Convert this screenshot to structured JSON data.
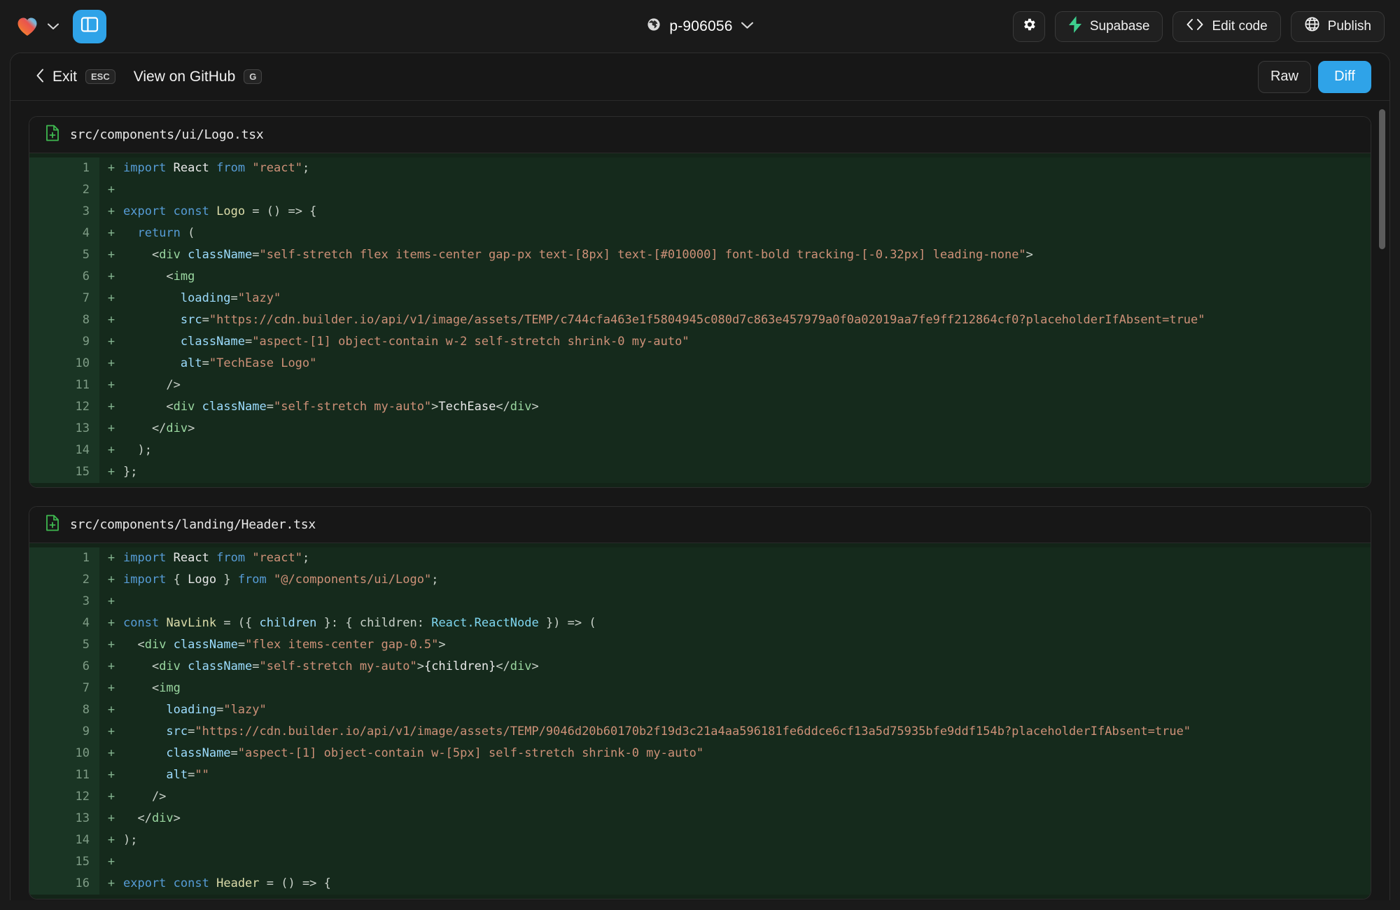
{
  "topbar": {
    "logo_icon": "heart-gradient-logo",
    "logo_chevron_icon": "chevron-down-icon",
    "panel_toggle_icon": "sidebar-panel-icon",
    "project": {
      "globe_icon": "globe-icon",
      "name": "p-906056",
      "chevron_icon": "chevron-down-icon"
    },
    "buttons": [
      {
        "id": "settings",
        "label": "",
        "icon": "gear-icon"
      },
      {
        "id": "supabase",
        "label": "Supabase",
        "icon": "supabase-bolt-icon"
      },
      {
        "id": "edit-code",
        "label": "Edit code",
        "icon": "code-brackets-icon"
      },
      {
        "id": "publish",
        "label": "Publish",
        "icon": "globe-icon"
      }
    ]
  },
  "panel_header": {
    "exit_label": "Exit",
    "exit_kbd": "ESC",
    "back_chevron_icon": "chevron-left-icon",
    "github_label": "View on GitHub",
    "github_kbd": "G",
    "view_modes": [
      {
        "id": "raw",
        "label": "Raw",
        "active": false
      },
      {
        "id": "diff",
        "label": "Diff",
        "active": true
      }
    ]
  },
  "colors": {
    "accent_blue": "#2fa3e8",
    "added_bg": "#152a1c",
    "added_gutter": "#1a3524",
    "file_icon_green": "#3fb950",
    "panel_bg": "#171717",
    "app_bg": "#1a1a1a"
  },
  "files": [
    {
      "path": "src/components/ui/Logo.tsx",
      "status_icon": "file-added-icon",
      "lines": [
        {
          "n": 1,
          "sign": "+",
          "spans": [
            {
              "t": "import",
              "c": "kw"
            },
            {
              "t": " ",
              "c": "pun"
            },
            {
              "t": "React",
              "c": "id"
            },
            {
              "t": " ",
              "c": "pun"
            },
            {
              "t": "from",
              "c": "kw"
            },
            {
              "t": " ",
              "c": "pun"
            },
            {
              "t": "\"react\"",
              "c": "str"
            },
            {
              "t": ";",
              "c": "pun"
            }
          ]
        },
        {
          "n": 2,
          "sign": "+",
          "spans": []
        },
        {
          "n": 3,
          "sign": "+",
          "spans": [
            {
              "t": "export",
              "c": "kw"
            },
            {
              "t": " ",
              "c": "pun"
            },
            {
              "t": "const",
              "c": "kw"
            },
            {
              "t": " ",
              "c": "pun"
            },
            {
              "t": "Logo",
              "c": "yel"
            },
            {
              "t": " = () => {",
              "c": "pun"
            }
          ]
        },
        {
          "n": 4,
          "sign": "+",
          "spans": [
            {
              "t": "  ",
              "c": "pun"
            },
            {
              "t": "return",
              "c": "kw"
            },
            {
              "t": " (",
              "c": "pun"
            }
          ]
        },
        {
          "n": 5,
          "sign": "+",
          "spans": [
            {
              "t": "    <",
              "c": "pun"
            },
            {
              "t": "div",
              "c": "tag"
            },
            {
              "t": " ",
              "c": "pun"
            },
            {
              "t": "className",
              "c": "attr"
            },
            {
              "t": "=",
              "c": "pun"
            },
            {
              "t": "\"self-stretch flex items-center gap-px text-[8px] text-[#010000] font-bold tracking-[-0.32px] leading-none\"",
              "c": "str"
            },
            {
              "t": ">",
              "c": "pun"
            }
          ]
        },
        {
          "n": 6,
          "sign": "+",
          "spans": [
            {
              "t": "      <",
              "c": "pun"
            },
            {
              "t": "img",
              "c": "tag"
            }
          ]
        },
        {
          "n": 7,
          "sign": "+",
          "spans": [
            {
              "t": "        ",
              "c": "pun"
            },
            {
              "t": "loading",
              "c": "attr"
            },
            {
              "t": "=",
              "c": "pun"
            },
            {
              "t": "\"lazy\"",
              "c": "str"
            }
          ]
        },
        {
          "n": 8,
          "sign": "+",
          "spans": [
            {
              "t": "        ",
              "c": "pun"
            },
            {
              "t": "src",
              "c": "attr"
            },
            {
              "t": "=",
              "c": "pun"
            },
            {
              "t": "\"https://cdn.builder.io/api/v1/image/assets/TEMP/c744cfa463e1f5804945c080d7c863e457979a0f0a02019aa7fe9ff212864cf0?placeholderIfAbsent=true\"",
              "c": "str"
            }
          ]
        },
        {
          "n": 9,
          "sign": "+",
          "spans": [
            {
              "t": "        ",
              "c": "pun"
            },
            {
              "t": "className",
              "c": "attr"
            },
            {
              "t": "=",
              "c": "pun"
            },
            {
              "t": "\"aspect-[1] object-contain w-2 self-stretch shrink-0 my-auto\"",
              "c": "str"
            }
          ]
        },
        {
          "n": 10,
          "sign": "+",
          "spans": [
            {
              "t": "        ",
              "c": "pun"
            },
            {
              "t": "alt",
              "c": "attr"
            },
            {
              "t": "=",
              "c": "pun"
            },
            {
              "t": "\"TechEase Logo\"",
              "c": "str"
            }
          ]
        },
        {
          "n": 11,
          "sign": "+",
          "spans": [
            {
              "t": "      />",
              "c": "pun"
            }
          ]
        },
        {
          "n": 12,
          "sign": "+",
          "spans": [
            {
              "t": "      <",
              "c": "pun"
            },
            {
              "t": "div",
              "c": "tag"
            },
            {
              "t": " ",
              "c": "pun"
            },
            {
              "t": "className",
              "c": "attr"
            },
            {
              "t": "=",
              "c": "pun"
            },
            {
              "t": "\"self-stretch my-auto\"",
              "c": "str"
            },
            {
              "t": ">",
              "c": "pun"
            },
            {
              "t": "TechEase",
              "c": "txt"
            },
            {
              "t": "</",
              "c": "pun"
            },
            {
              "t": "div",
              "c": "tag"
            },
            {
              "t": ">",
              "c": "pun"
            }
          ]
        },
        {
          "n": 13,
          "sign": "+",
          "spans": [
            {
              "t": "    </",
              "c": "pun"
            },
            {
              "t": "div",
              "c": "tag"
            },
            {
              "t": ">",
              "c": "pun"
            }
          ]
        },
        {
          "n": 14,
          "sign": "+",
          "spans": [
            {
              "t": "  );",
              "c": "pun"
            }
          ]
        },
        {
          "n": 15,
          "sign": "+",
          "spans": [
            {
              "t": "};",
              "c": "pun"
            }
          ]
        }
      ]
    },
    {
      "path": "src/components/landing/Header.tsx",
      "status_icon": "file-added-icon",
      "lines": [
        {
          "n": 1,
          "sign": "+",
          "spans": [
            {
              "t": "import",
              "c": "kw"
            },
            {
              "t": " ",
              "c": "pun"
            },
            {
              "t": "React",
              "c": "id"
            },
            {
              "t": " ",
              "c": "pun"
            },
            {
              "t": "from",
              "c": "kw"
            },
            {
              "t": " ",
              "c": "pun"
            },
            {
              "t": "\"react\"",
              "c": "str"
            },
            {
              "t": ";",
              "c": "pun"
            }
          ]
        },
        {
          "n": 2,
          "sign": "+",
          "spans": [
            {
              "t": "import",
              "c": "kw"
            },
            {
              "t": " { ",
              "c": "pun"
            },
            {
              "t": "Logo",
              "c": "id"
            },
            {
              "t": " } ",
              "c": "pun"
            },
            {
              "t": "from",
              "c": "kw"
            },
            {
              "t": " ",
              "c": "pun"
            },
            {
              "t": "\"@/components/ui/Logo\"",
              "c": "str"
            },
            {
              "t": ";",
              "c": "pun"
            }
          ]
        },
        {
          "n": 3,
          "sign": "+",
          "spans": []
        },
        {
          "n": 4,
          "sign": "+",
          "spans": [
            {
              "t": "const",
              "c": "kw"
            },
            {
              "t": " ",
              "c": "pun"
            },
            {
              "t": "NavLink",
              "c": "yel"
            },
            {
              "t": " = ({ ",
              "c": "pun"
            },
            {
              "t": "children",
              "c": "attr"
            },
            {
              "t": " }: { ",
              "c": "pun"
            },
            {
              "t": "children",
              "c": "pun"
            },
            {
              "t": ": ",
              "c": "pun"
            },
            {
              "t": "React.ReactNode",
              "c": "ty"
            },
            {
              "t": " }) => (",
              "c": "pun"
            }
          ]
        },
        {
          "n": 5,
          "sign": "+",
          "spans": [
            {
              "t": "  <",
              "c": "pun"
            },
            {
              "t": "div",
              "c": "tag"
            },
            {
              "t": " ",
              "c": "pun"
            },
            {
              "t": "className",
              "c": "attr"
            },
            {
              "t": "=",
              "c": "pun"
            },
            {
              "t": "\"flex items-center gap-0.5\"",
              "c": "str"
            },
            {
              "t": ">",
              "c": "pun"
            }
          ]
        },
        {
          "n": 6,
          "sign": "+",
          "spans": [
            {
              "t": "    <",
              "c": "pun"
            },
            {
              "t": "div",
              "c": "tag"
            },
            {
              "t": " ",
              "c": "pun"
            },
            {
              "t": "className",
              "c": "attr"
            },
            {
              "t": "=",
              "c": "pun"
            },
            {
              "t": "\"self-stretch my-auto\"",
              "c": "str"
            },
            {
              "t": ">",
              "c": "pun"
            },
            {
              "t": "{children}",
              "c": "txt"
            },
            {
              "t": "</",
              "c": "pun"
            },
            {
              "t": "div",
              "c": "tag"
            },
            {
              "t": ">",
              "c": "pun"
            }
          ]
        },
        {
          "n": 7,
          "sign": "+",
          "spans": [
            {
              "t": "    <",
              "c": "pun"
            },
            {
              "t": "img",
              "c": "tag"
            }
          ]
        },
        {
          "n": 8,
          "sign": "+",
          "spans": [
            {
              "t": "      ",
              "c": "pun"
            },
            {
              "t": "loading",
              "c": "attr"
            },
            {
              "t": "=",
              "c": "pun"
            },
            {
              "t": "\"lazy\"",
              "c": "str"
            }
          ]
        },
        {
          "n": 9,
          "sign": "+",
          "spans": [
            {
              "t": "      ",
              "c": "pun"
            },
            {
              "t": "src",
              "c": "attr"
            },
            {
              "t": "=",
              "c": "pun"
            },
            {
              "t": "\"https://cdn.builder.io/api/v1/image/assets/TEMP/9046d20b60170b2f19d3c21a4aa596181fe6ddce6cf13a5d75935bfe9ddf154b?placeholderIfAbsent=true\"",
              "c": "str"
            }
          ]
        },
        {
          "n": 10,
          "sign": "+",
          "spans": [
            {
              "t": "      ",
              "c": "pun"
            },
            {
              "t": "className",
              "c": "attr"
            },
            {
              "t": "=",
              "c": "pun"
            },
            {
              "t": "\"aspect-[1] object-contain w-[5px] self-stretch shrink-0 my-auto\"",
              "c": "str"
            }
          ]
        },
        {
          "n": 11,
          "sign": "+",
          "spans": [
            {
              "t": "      ",
              "c": "pun"
            },
            {
              "t": "alt",
              "c": "attr"
            },
            {
              "t": "=",
              "c": "pun"
            },
            {
              "t": "\"\"",
              "c": "str"
            }
          ]
        },
        {
          "n": 12,
          "sign": "+",
          "spans": [
            {
              "t": "    />",
              "c": "pun"
            }
          ]
        },
        {
          "n": 13,
          "sign": "+",
          "spans": [
            {
              "t": "  </",
              "c": "pun"
            },
            {
              "t": "div",
              "c": "tag"
            },
            {
              "t": ">",
              "c": "pun"
            }
          ]
        },
        {
          "n": 14,
          "sign": "+",
          "spans": [
            {
              "t": ");",
              "c": "pun"
            }
          ]
        },
        {
          "n": 15,
          "sign": "+",
          "spans": []
        },
        {
          "n": 16,
          "sign": "+",
          "spans": [
            {
              "t": "export",
              "c": "kw"
            },
            {
              "t": " ",
              "c": "pun"
            },
            {
              "t": "const",
              "c": "kw"
            },
            {
              "t": " ",
              "c": "pun"
            },
            {
              "t": "Header",
              "c": "yel"
            },
            {
              "t": " = () => {",
              "c": "pun"
            }
          ]
        }
      ]
    }
  ]
}
